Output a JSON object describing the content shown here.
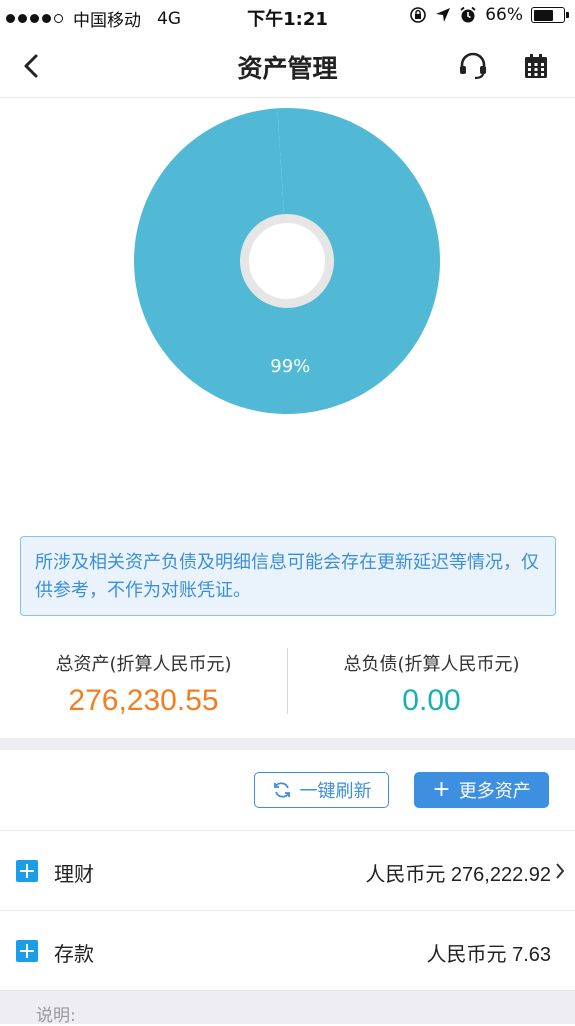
{
  "status_bar": {
    "carrier": "中国移动",
    "network": "4G",
    "time": "下午1:21",
    "battery_percent": "66%",
    "battery_level": 0.66
  },
  "nav": {
    "title": "资产管理",
    "back_icon": "chevron-left-icon",
    "service_icon": "headset-icon",
    "calendar_icon": "calendar-icon"
  },
  "chart_data": {
    "type": "pie",
    "title": "",
    "slices": [
      {
        "label": "理财",
        "value": 99,
        "color": "#51b9d6",
        "display": "99%"
      },
      {
        "label": "存款",
        "value": 1,
        "color": "#51b9d6",
        "display": ""
      }
    ],
    "hole_color": "#ffffff",
    "hole_ring_color": "#e6e6e6"
  },
  "notice": {
    "text": "所涉及相关资产负债及明细信息可能会存在更新延迟等情况，仅供参考，不作为对账凭证。"
  },
  "totals": {
    "assets_label": "总资产(折算人民币元)",
    "assets_value": "276,230.55",
    "debts_label": "总负债(折算人民币元)",
    "debts_value": "0.00",
    "assets_color": "#f47d20",
    "debts_color": "#18b0b2"
  },
  "actions": {
    "refresh_label": "一键刷新",
    "more_label": "更多资产",
    "refresh_icon": "refresh-icon",
    "more_icon": "plus-icon"
  },
  "rows": [
    {
      "label": "理财",
      "value": "人民币元 276,222.92",
      "has_chevron": true
    },
    {
      "label": "存款",
      "value": "人民币元 7.63",
      "has_chevron": false
    }
  ],
  "footer": {
    "text": "说明:"
  }
}
